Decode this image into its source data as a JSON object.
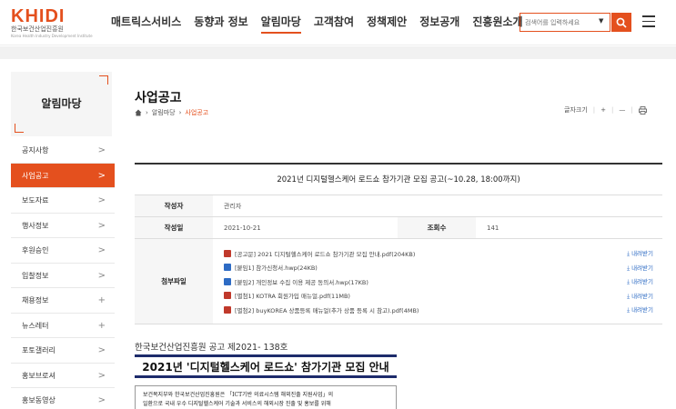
{
  "header": {
    "logo_mark": "KHIDI",
    "logo_sub": "한국보건산업진흥원",
    "logo_sub2": "Korea Health Industry Development Institute",
    "nav": [
      "매트릭스서비스",
      "동향과 정보",
      "알림마당",
      "고객참여",
      "정책제안",
      "정보공개",
      "진흥원소개"
    ],
    "active_nav": "알림마당",
    "search_placeholder": "검색어를 입력하세요",
    "accent_color": "#e4501e"
  },
  "sidebar": {
    "title": "알림마당",
    "items": [
      {
        "label": "공지사항",
        "icon": ">"
      },
      {
        "label": "사업공고",
        "icon": ">",
        "active": true
      },
      {
        "label": "보도자료",
        "icon": ">"
      },
      {
        "label": "행사정보",
        "icon": ">"
      },
      {
        "label": "후원승인",
        "icon": ">"
      },
      {
        "label": "입찰정보",
        "icon": ">"
      },
      {
        "label": "채용정보",
        "icon": "+"
      },
      {
        "label": "뉴스레터",
        "icon": "+"
      },
      {
        "label": "포토갤러리",
        "icon": ">"
      },
      {
        "label": "홍보브로셔",
        "icon": ">"
      },
      {
        "label": "홍보동영상",
        "icon": ">"
      }
    ]
  },
  "content": {
    "page_title": "사업공고",
    "breadcrumb": [
      "알림마당",
      "사업공고"
    ],
    "font_size_label": "글자크기",
    "notice": {
      "title": "2021년 디지털헬스케어 로드쇼 참가기관 모집 공고(~10.28, 18:00까지)",
      "author_label": "작성자",
      "author": "관리자",
      "date_label": "작성일",
      "date": "2021-10-21",
      "views_label": "조회수",
      "views": "141",
      "files_label": "첨부파일",
      "download_label": "내려받기",
      "files": [
        {
          "name": "[공고문] 2021 디지털헬스케어 로드쇼 참가기관 모집 안내.pdf(204KB)",
          "type": "pdf"
        },
        {
          "name": "[붙임1] 참가신청서.hwp(24KB)",
          "type": "hwp"
        },
        {
          "name": "[붙임2] 개인정보 수집 이용 제공 동의서.hwp(17KB)",
          "type": "hwp"
        },
        {
          "name": "[별첨1] KOTRA 회원가입 매뉴얼.pdf(11MB)",
          "type": "pdf"
        },
        {
          "name": "[별첨2] buyKOREA 상품등록 매뉴얼(추가 상품 등록 시 참고).pdf(4MB)",
          "type": "pdf"
        }
      ]
    },
    "doc": {
      "org_line": "한국보건산업진흥원 공고 제2021- 138호",
      "banner": "2021년 '디지털헬스케어 로드쇼' 참가기관 모집 안내",
      "body_line1": "보건복지부와 한국보건산업진흥원은 「ICT기반 의료시스템 해외진출 지원사업」의",
      "body_line2": "일환으로 국내 우수 디지털헬스케어 기술과 서비스의 해외시장 진출 및 홍보를 위해"
    }
  }
}
